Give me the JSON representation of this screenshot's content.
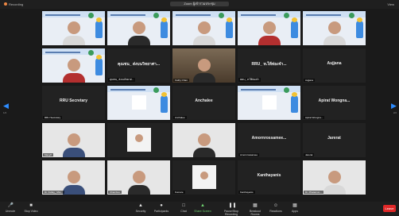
{
  "topbar": {
    "recording": "Recording",
    "title": "Zoom ผู้เข้าร่วมประชุม",
    "view": "View"
  },
  "tiles": [
    {
      "name": "",
      "kind": "slide-person",
      "shirt": "",
      "face": ""
    },
    {
      "name": "",
      "kind": "slide-person",
      "shirt": "dark",
      "face": ""
    },
    {
      "name": "",
      "kind": "slide-person",
      "shirt": "",
      "face": ""
    },
    {
      "name": "",
      "kind": "slide-person",
      "shirt": "red",
      "face": ""
    },
    {
      "name": "",
      "kind": "slide-person",
      "shirt": "",
      "face": ""
    },
    {
      "name": "",
      "kind": "slide-person-mask",
      "shirt": "red",
      "face": ""
    },
    {
      "name": "คุณชน_ ส่งบนวิทยาศา...",
      "kind": "text",
      "label": "คุณชน_ ส่งบนวิทยาศา...",
      "tag": "คุณชน_ ส่งบนวิทยาศ..."
    },
    {
      "name": "",
      "kind": "room",
      "tag": "Cathy Chan"
    },
    {
      "name": "RRU_ ท.ให้ท่องจำ...",
      "kind": "text",
      "label": "RRU_ ท.ให้ท่องจำ...",
      "tag": "RRU_ ท.ให้ท่องจำ"
    },
    {
      "name": "Aujjana",
      "kind": "text",
      "label": "Aujjana",
      "tag": "Aujjana"
    },
    {
      "name": "RRU Secretary",
      "kind": "text",
      "label": "RRU Secretary",
      "tag": "RRU Secretary"
    },
    {
      "name": "",
      "kind": "slide"
    },
    {
      "name": "Anchalee",
      "kind": "text",
      "label": "Anchalee",
      "tag": "Anchalee"
    },
    {
      "name": "",
      "kind": "slide"
    },
    {
      "name": "Apirat Wongna...",
      "kind": "text",
      "label": "Apirat Wongna...",
      "tag": "Apirat Wongna..."
    },
    {
      "name": "",
      "kind": "person-photo",
      "shirt": "blue",
      "tag": "ManyP"
    },
    {
      "name": "",
      "kind": "framed",
      "tag": ""
    },
    {
      "name": "",
      "kind": "person-photo",
      "shirt": "dark",
      "tag": ""
    },
    {
      "name": "Amornrossamee...",
      "kind": "text",
      "label": "Amornrossamee...",
      "tag": "Amornrossamee"
    },
    {
      "name": "Jarerat",
      "kind": "text",
      "label": "Jarerat",
      "tag": "Jarerat"
    },
    {
      "name": "",
      "kind": "person-photo",
      "shirt": "blue",
      "tag": "Dr. Kullay_ Mot..."
    },
    {
      "name": "",
      "kind": "person-photo",
      "shirt": "dark",
      "tag": "Chamboo"
    },
    {
      "name": "",
      "kind": "framed",
      "tag": "Kumare"
    },
    {
      "name": "Kanthayanis",
      "kind": "text",
      "label": "Kanthayanis",
      "tag": "Kanthayanis"
    },
    {
      "name": "",
      "kind": "person-photo",
      "shirt": "",
      "tag": "Dr. Phatamun..."
    }
  ],
  "pager": {
    "left": "1/2",
    "right": "2/2"
  },
  "toolbar": {
    "mute": "Unmute",
    "video": "Stop Video",
    "security": "Security",
    "participants": "Participants",
    "chat": "Chat",
    "share": "Share Screen",
    "record": "Pause/Stop Recording",
    "breakout": "Breakout Rooms",
    "reactions": "Reactions",
    "apps": "Apps",
    "end": "Leave"
  },
  "colors": {
    "accent": "#2d8cff",
    "end": "#e02828"
  }
}
